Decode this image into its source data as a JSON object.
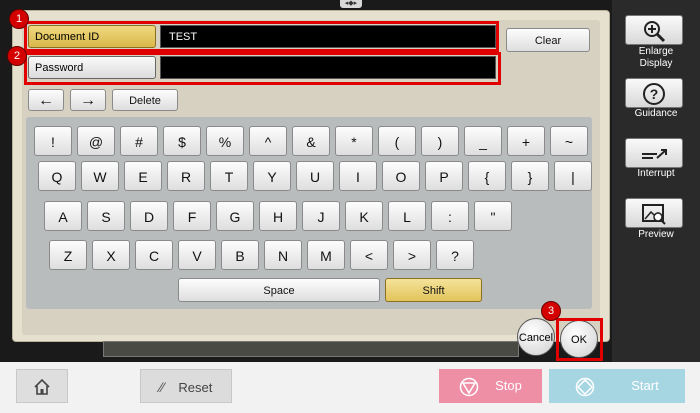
{
  "top_handle": "◂◆▸",
  "fields": {
    "document_id": {
      "label": "Document ID",
      "value": "TEST"
    },
    "password": {
      "label": "Password",
      "value": ""
    }
  },
  "clear_label": "Clear",
  "nav": {
    "left_arrow": "←",
    "right_arrow": "→",
    "delete_label": "Delete"
  },
  "keyboard": {
    "row1": [
      "!",
      "@",
      "#",
      "$",
      "%",
      "^",
      "&",
      "*",
      "(",
      ")",
      "_",
      "+",
      "~"
    ],
    "row2": [
      "Q",
      "W",
      "E",
      "R",
      "T",
      "Y",
      "U",
      "I",
      "O",
      "P",
      "{",
      "}",
      "|"
    ],
    "row3": [
      "A",
      "S",
      "D",
      "F",
      "G",
      "H",
      "J",
      "K",
      "L",
      ":",
      "\""
    ],
    "row4": [
      "Z",
      "X",
      "C",
      "V",
      "B",
      "N",
      "M",
      "<",
      ">",
      "?"
    ],
    "space_label": "Space",
    "shift_label": "Shift"
  },
  "badges": {
    "one": "1",
    "two": "2",
    "three": "3"
  },
  "cancel_label": "Cancel",
  "ok_label": "OK",
  "sidebar": {
    "enlarge_label_1": "Enlarge",
    "enlarge_label_2": "Display",
    "guidance_label": "Guidance",
    "interrupt_label": "Interrupt",
    "preview_label": "Preview"
  },
  "bottom": {
    "reset_label": "Reset",
    "stop_label": "Stop",
    "start_label": "Start"
  },
  "colors": {
    "highlight": "#e00000",
    "active_field": "#e2c45b",
    "stop": "#ee8fa6",
    "start": "#a7d6e3"
  }
}
